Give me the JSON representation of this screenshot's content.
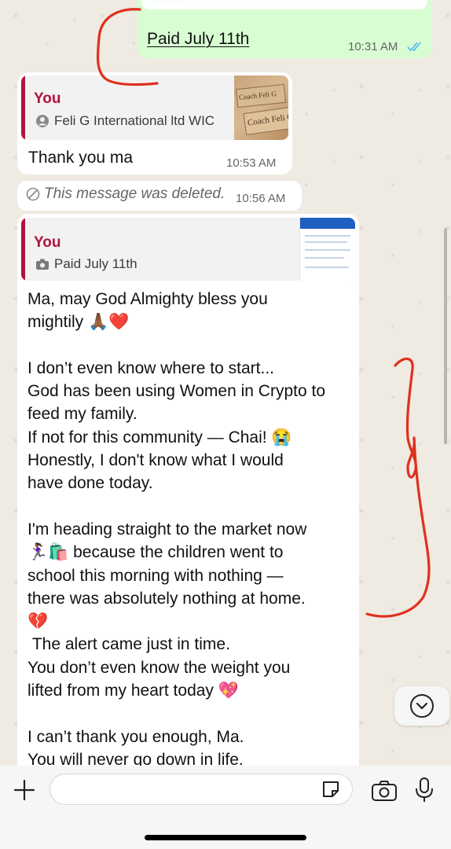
{
  "colors": {
    "outgoing_bubble": "#d9fdd3",
    "incoming_bubble": "#ffffff",
    "quote_accent": "#b3123a",
    "read_ticks": "#53bdeb",
    "chat_background": "#efeae2",
    "annotation_ink": "#e0301e"
  },
  "messages": [
    {
      "id": "paid-msg",
      "direction": "outgoing",
      "text": "Paid July 11th",
      "time": "10:31 AM",
      "status_icon": "double-check-read-icon"
    },
    {
      "id": "thanks-msg",
      "direction": "incoming",
      "quote": {
        "author": "You",
        "text": "Feli G International ltd WIC",
        "icon": "contact-icon",
        "thumbnail_texts": [
          "Coach Feli G",
          "Coach Feli G"
        ]
      },
      "text": "Thank you ma",
      "time": "10:53 AM"
    },
    {
      "id": "deleted-msg",
      "direction": "incoming",
      "text": "This message was deleted.",
      "time": "10:56 AM",
      "icon": "blocked-icon"
    },
    {
      "id": "long-msg",
      "direction": "incoming",
      "quote": {
        "author": "You",
        "text": "Paid July 11th",
        "icon": "camera-icon"
      },
      "text": "Ma, may God Almighty bless you\nmightily 🙏🏾❤️\n\nI don’t even know where to start...\nGod has been using Women in Crypto to\nfeed my family.\nIf not for this community — Chai! 😭\nHonestly, I don't know what I would\nhave done today.\n\nI'm heading straight to the market now\n🏃🏾‍♀️🛍️ because the children went to\nschool this morning with nothing —\nthere was absolutely nothing at home.\n💔\n The alert came just in time.\nYou don’t even know the weight you\nlifted from my heart today 💖\n\nI can’t thank you enough, Ma.\nYou will never go down in life."
    }
  ],
  "input_bar": {
    "attach_icon": "plus-icon",
    "message_placeholder": "",
    "sticker_icon": "sticker-icon",
    "camera_icon": "camera-icon",
    "mic_icon": "microphone-icon"
  },
  "scroll_button_icon": "chevron-down-icon"
}
